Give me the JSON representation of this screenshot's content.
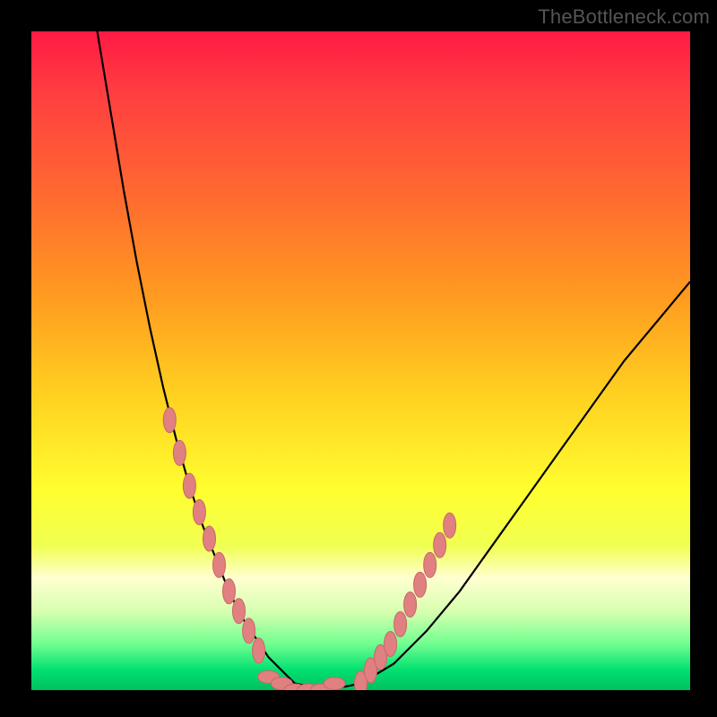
{
  "watermark": "TheBottleneck.com",
  "chart_data": {
    "type": "line",
    "title": "",
    "xlabel": "",
    "ylabel": "",
    "xlim": [
      0,
      100
    ],
    "ylim": [
      0,
      100
    ],
    "curve": {
      "x": [
        10,
        12,
        14,
        16,
        18,
        20,
        22,
        24,
        26,
        28,
        30,
        32,
        34,
        36,
        38,
        40,
        45,
        50,
        55,
        60,
        65,
        70,
        75,
        80,
        85,
        90,
        95,
        100
      ],
      "y": [
        100,
        88,
        76,
        65,
        55,
        46,
        38,
        31,
        25,
        20,
        15,
        11,
        8,
        5,
        3,
        1,
        0,
        1,
        4,
        9,
        15,
        22,
        29,
        36,
        43,
        50,
        56,
        62
      ]
    },
    "markers_left": {
      "x": [
        21,
        22.5,
        24,
        25.5,
        27,
        28.5,
        30,
        31.5,
        33,
        34.5
      ],
      "y": [
        41,
        36,
        31,
        27,
        23,
        19,
        15,
        12,
        9,
        6
      ]
    },
    "markers_right": {
      "x": [
        50,
        51.5,
        53,
        54.5,
        56,
        57.5,
        59,
        60.5,
        62,
        63.5
      ],
      "y": [
        1,
        3,
        5,
        7,
        10,
        13,
        16,
        19,
        22,
        25
      ]
    },
    "markers_bottom": {
      "x": [
        36,
        38,
        40,
        42,
        44,
        46
      ],
      "y": [
        2,
        1,
        0,
        0,
        0,
        1
      ]
    },
    "colors": {
      "curve": "#000000",
      "marker_fill": "#e08080",
      "marker_stroke": "#c86868"
    }
  }
}
